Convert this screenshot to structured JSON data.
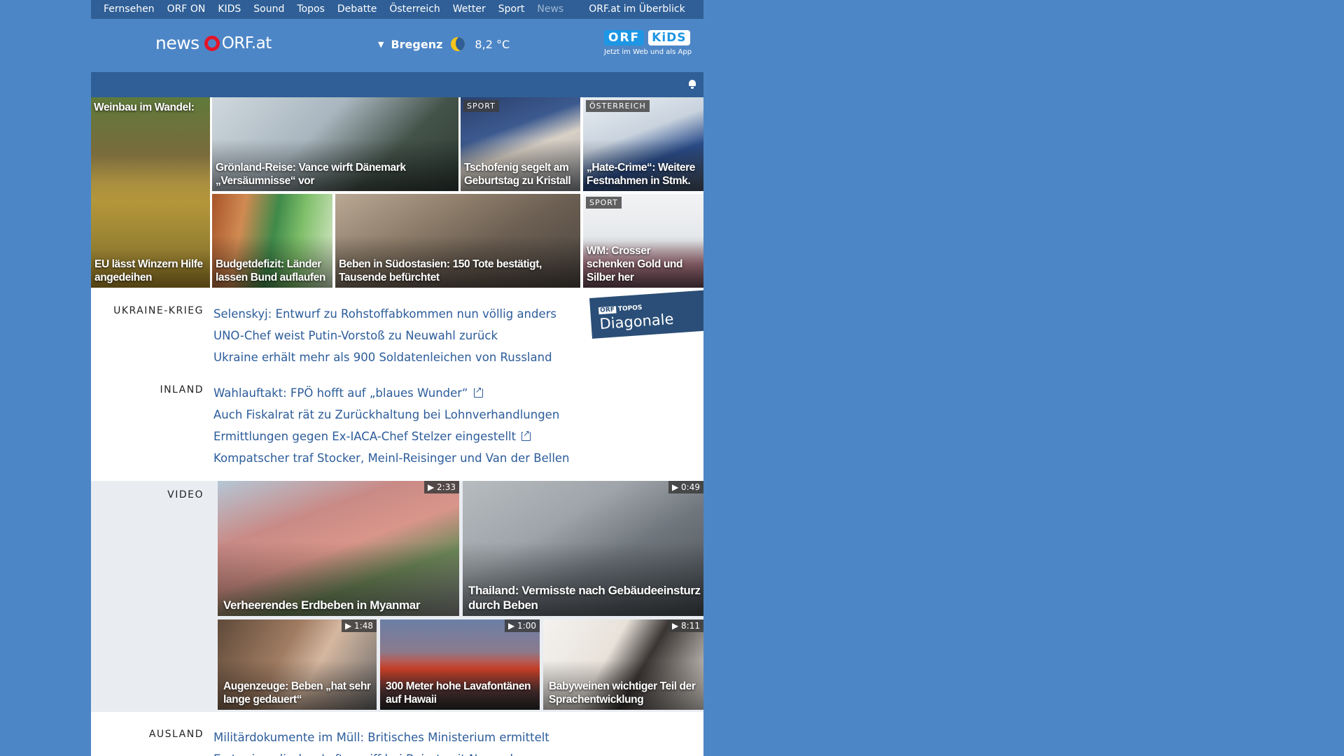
{
  "nav": {
    "items": [
      "Fernsehen",
      "ORF ON",
      "KIDS",
      "Sound",
      "Topos",
      "Debatte",
      "Österreich",
      "Wetter",
      "Sport",
      "News"
    ],
    "overview": "ORF.at im Überblick"
  },
  "header": {
    "logo_news": "news",
    "logo_orf": "ORF.at",
    "weather": {
      "location": "Bregenz",
      "temperature": "8,2 °C",
      "icon": "moon-icon"
    },
    "kids": {
      "orf": "ORF",
      "kids": "KiDS",
      "tagline": "Jetzt im Web und als App"
    }
  },
  "tiles": [
    {
      "top_title": "Weinbau im Wandel:",
      "caption": "EU lässt Winzern Hilfe angedeihen",
      "label": ""
    },
    {
      "caption": "Grönland-Reise: Vance wirft Dänemark „Versäumnisse“ vor",
      "label": ""
    },
    {
      "caption": "Tschofenig segelt am Geburtstag zu Kristall",
      "label": "SPORT"
    },
    {
      "caption": "„Hate-Crime“: Weitere Festnahmen in Stmk.",
      "label": "ÖSTERREICH"
    },
    {
      "caption": "Budgetdefizit: Länder lassen Bund auflaufen",
      "label": ""
    },
    {
      "caption": "Beben in Südostasien: 150 Tote bestätigt, Tausende befürchtet",
      "label": ""
    },
    {
      "caption": "WM: Crosser schenken Gold und Silber her",
      "label": "SPORT"
    }
  ],
  "sections": {
    "ukraine": {
      "label": "UKRAINE-KRIEG",
      "links": [
        "Selenskyj: Entwurf zu Rohstoffabkommen nun völlig anders",
        "UNO-Chef weist Putin-Vorstoß zu Neuwahl zurück",
        "Ukraine erhält mehr als 900 Soldatenleichen von Russland"
      ]
    },
    "inland": {
      "label": "INLAND",
      "links": [
        "Wahlauftakt: FPÖ hofft auf „blaues Wunder“",
        "Auch Fiskalrat rät zu Zurückhaltung bei Lohnverhandlungen",
        "Ermittlungen gegen Ex-IACA-Chef Stelzer eingestellt",
        "Kompatscher traf Stocker, Meinl-Reisinger und Van der Bellen"
      ]
    },
    "video": {
      "label": "VIDEO",
      "items": [
        {
          "caption": "Verheerendes Erdbeben in Myanmar",
          "duration": "▶ 2:33"
        },
        {
          "caption": "Thailand: Vermisste nach Gebäudeeinsturz durch Beben",
          "duration": "▶ 0:49"
        },
        {
          "caption": "Augenzeuge: Beben „hat sehr lange gedauert“",
          "duration": "▶ 1:48"
        },
        {
          "caption": "300 Meter hohe Lavafontänen auf Hawaii",
          "duration": "▶ 1:00"
        },
        {
          "caption": "Babyweinen wichtiger Teil der Sprachentwicklung",
          "duration": "▶ 8:11"
        }
      ]
    },
    "ausland": {
      "label": "AUSLAND",
      "links": [
        "Militärdokumente im Müll: Britisches Ministerium ermittelt",
        "Erster israelischer Luftangriff bei Beirut seit November"
      ]
    }
  },
  "promo": {
    "brand": "ORF",
    "sub": "TOPOS",
    "title": "Diagonale"
  },
  "colors": {
    "background": "#4d86c6",
    "bar": "#2f5f96",
    "link": "#2c5c9a",
    "logo_red": "#e3152a"
  }
}
